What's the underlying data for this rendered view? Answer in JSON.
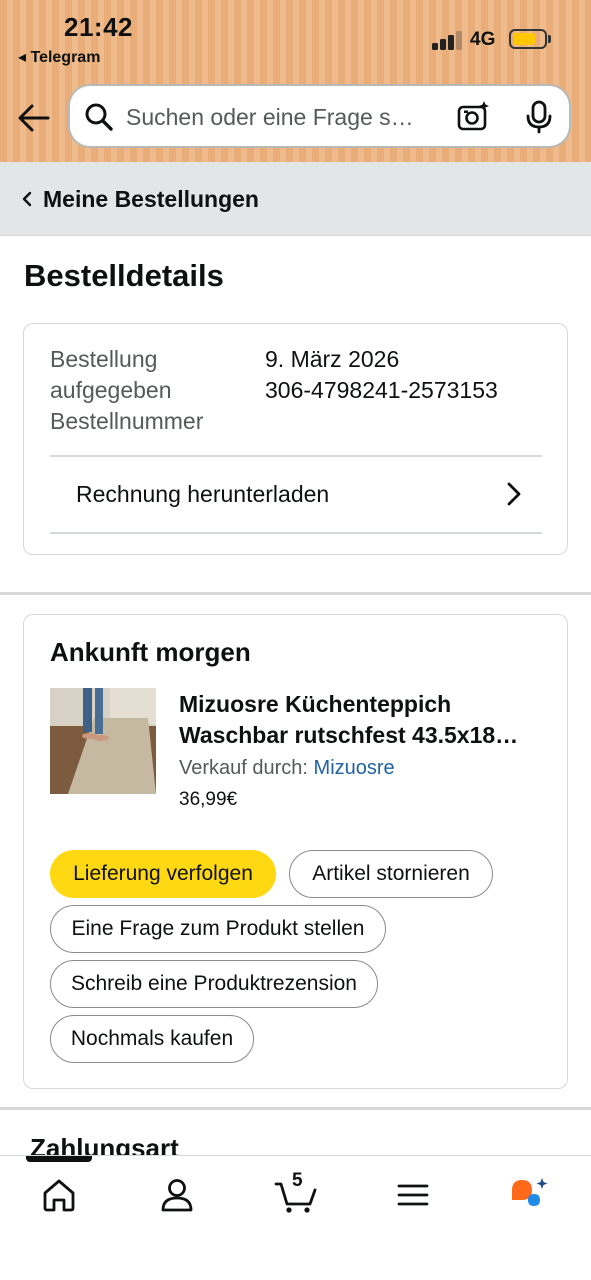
{
  "status_bar": {
    "time": "21:42",
    "back_app": "◂ Telegram",
    "network": "4G"
  },
  "search": {
    "placeholder": "Suchen oder eine Frage s…"
  },
  "breadcrumb": {
    "label": "Meine Bestellungen"
  },
  "page_title": "Bestelldetails",
  "order_info": {
    "labels": [
      "Bestellung",
      "aufgegeben",
      "Bestellnummer"
    ],
    "values": [
      "9. März 2026",
      "306-4798241-2573153"
    ],
    "invoice_label": "Rechnung herunterladen"
  },
  "shipment": {
    "title": "Ankunft morgen",
    "product_name_lines": [
      "Mizuosre Küchenteppich",
      "Waschbar rutschfest 43.5x18…"
    ],
    "seller_prefix": "Verkauf durch:",
    "seller_name": "Mizuosre",
    "price": "36,99€",
    "buttons": {
      "track": "Lieferung verfolgen",
      "cancel": "Artikel stornieren",
      "ask": "Eine Frage zum Produkt stellen",
      "review": "Schreib eine Produktrezension",
      "buy_again": "Nochmals kaufen"
    }
  },
  "payment": {
    "title": "Zahlungsart"
  },
  "tabbar": {
    "cart_count": "5",
    "icons": [
      "home-icon",
      "account-icon",
      "cart-icon",
      "menu-icon",
      "assistant-icon"
    ]
  },
  "colors": {
    "header_stripe": "#e9ad79",
    "primary_button": "#ffd814",
    "link": "#2162a1",
    "battery": "#ffc700",
    "assistant_orange": "#ff6a1a",
    "assistant_blue": "#1f8ae8"
  }
}
